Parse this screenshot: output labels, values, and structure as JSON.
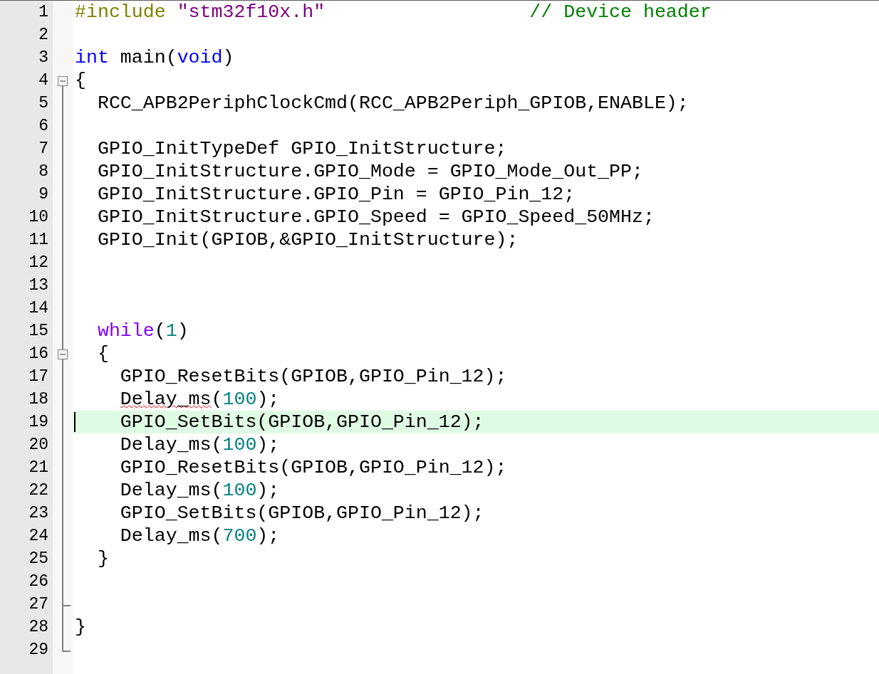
{
  "editor": {
    "lines": [
      {
        "number": "1",
        "kind": "plain",
        "current": false,
        "tokens": [
          {
            "text": "#include",
            "kind": "preproc"
          },
          {
            "text": " \"stm32f10x.h\"",
            "kind": "string"
          },
          {
            "text": "                  // Device header",
            "kind": "comment"
          }
        ]
      },
      {
        "number": "2",
        "kind": "plain",
        "current": false
      },
      {
        "number": "3",
        "kind": "plain",
        "current": false,
        "tokens": [
          {
            "text": "int",
            "kind": "keyword"
          },
          {
            "text": " main(",
            "kind": "plain"
          },
          {
            "text": "void",
            "kind": "keyword"
          },
          {
            "text": ")",
            "kind": "plain"
          }
        ]
      },
      {
        "number": "4",
        "kind": "foldstart",
        "current": false,
        "tokens": [
          {
            "text": "{",
            "kind": "plain"
          }
        ]
      },
      {
        "number": "5",
        "kind": "folded",
        "current": false,
        "tokens": [
          {
            "text": "  RCC_APB2PeriphClockCmd(RCC_APB2Periph_GPIOB,ENABLE);",
            "kind": "plain"
          }
        ]
      },
      {
        "number": "6",
        "kind": "folded",
        "current": false
      },
      {
        "number": "7",
        "kind": "folded",
        "current": false,
        "tokens": [
          {
            "text": "  GPIO_InitTypeDef GPIO_InitStructure;",
            "kind": "plain"
          }
        ]
      },
      {
        "number": "8",
        "kind": "folded",
        "current": false,
        "tokens": [
          {
            "text": "  GPIO_InitStructure.GPIO_Mode = GPIO_Mode_Out_PP;",
            "kind": "plain"
          }
        ]
      },
      {
        "number": "9",
        "kind": "folded",
        "current": false,
        "tokens": [
          {
            "text": "  GPIO_InitStructure.GPIO_Pin = GPIO_Pin_12;",
            "kind": "plain"
          }
        ]
      },
      {
        "number": "10",
        "kind": "folded",
        "current": false,
        "tokens": [
          {
            "text": "  GPIO_InitStructure.GPIO_Speed = GPIO_Speed_50MHz;",
            "kind": "plain"
          }
        ]
      },
      {
        "number": "11",
        "kind": "folded",
        "current": false,
        "tokens": [
          {
            "text": "  GPIO_Init(GPIOB,&GPIO_InitStructure);",
            "kind": "plain"
          }
        ]
      },
      {
        "number": "12",
        "kind": "folded",
        "current": false
      },
      {
        "number": "13",
        "kind": "folded",
        "current": false
      },
      {
        "number": "14",
        "kind": "folded",
        "current": false
      },
      {
        "number": "15",
        "kind": "folded",
        "current": false,
        "tokens": [
          {
            "text": "  while",
            "kind": "keyword2"
          },
          {
            "text": "(",
            "kind": "plain"
          },
          {
            "text": "1",
            "kind": "number"
          },
          {
            "text": ")",
            "kind": "plain"
          }
        ]
      },
      {
        "number": "16",
        "kind": "nestedstart",
        "current": false,
        "tokens": [
          {
            "text": "  {",
            "kind": "plain"
          }
        ]
      },
      {
        "number": "17",
        "kind": "folded",
        "current": false,
        "tokens": [
          {
            "text": "    GPIO_ResetBits(GPIOB,GPIO_Pin_12);",
            "kind": "plain"
          }
        ]
      },
      {
        "number": "18",
        "kind": "folded",
        "current": false,
        "tokens": [
          {
            "text": "    Delay_ms",
            "kind": "error"
          },
          {
            "text": "(",
            "kind": "plain"
          },
          {
            "text": "100",
            "kind": "number"
          },
          {
            "text": ");",
            "kind": "plain"
          }
        ]
      },
      {
        "number": "19",
        "kind": "folded",
        "current": true,
        "tokens": [
          {
            "text": "    GPIO_SetBits(GPIOB,GPIO_Pin_12);",
            "kind": "plain"
          }
        ]
      },
      {
        "number": "20",
        "kind": "folded",
        "current": false,
        "tokens": [
          {
            "text": "    Delay_ms(",
            "kind": "plain"
          },
          {
            "text": "100",
            "kind": "number"
          },
          {
            "text": ");",
            "kind": "plain"
          }
        ]
      },
      {
        "number": "21",
        "kind": "folded",
        "current": false,
        "tokens": [
          {
            "text": "    GPIO_ResetBits(GPIOB,GPIO_Pin_12);",
            "kind": "plain"
          }
        ]
      },
      {
        "number": "22",
        "kind": "folded",
        "current": false,
        "tokens": [
          {
            "text": "    Delay_ms(",
            "kind": "plain"
          },
          {
            "text": "100",
            "kind": "number"
          },
          {
            "text": ");",
            "kind": "plain"
          }
        ]
      },
      {
        "number": "23",
        "kind": "folded",
        "current": false,
        "tokens": [
          {
            "text": "    GPIO_SetBits(GPIOB,GPIO_Pin_12);",
            "kind": "plain"
          }
        ]
      },
      {
        "number": "24",
        "kind": "folded",
        "current": false,
        "tokens": [
          {
            "text": "    Delay_ms(",
            "kind": "plain"
          },
          {
            "text": "700",
            "kind": "number"
          },
          {
            "text": ");",
            "kind": "plain"
          }
        ]
      },
      {
        "number": "25",
        "kind": "folded",
        "current": false,
        "tokens": [
          {
            "text": "  }",
            "kind": "plain"
          }
        ]
      },
      {
        "number": "26",
        "kind": "folded",
        "current": false
      },
      {
        "number": "27",
        "kind": "foldtick",
        "current": false
      },
      {
        "number": "28",
        "kind": "folded",
        "current": false,
        "tokens": [
          {
            "text": "}",
            "kind": "plain"
          }
        ]
      },
      {
        "number": "29",
        "kind": "foldend",
        "current": false
      }
    ]
  }
}
